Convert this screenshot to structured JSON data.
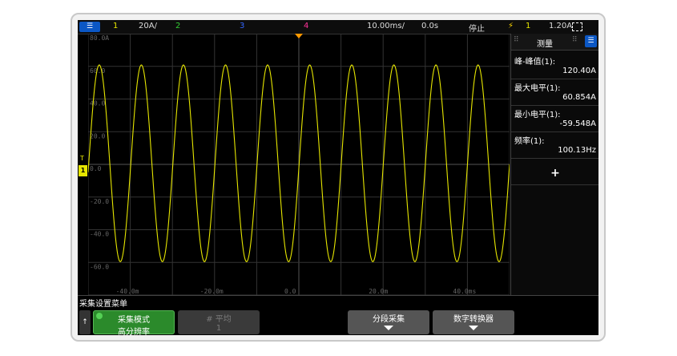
{
  "topbar": {
    "menu_icon": "menu-icon",
    "ch1": "1",
    "ch1_scale": "20A/",
    "ch2": "2",
    "ch3": "3",
    "ch4": "4",
    "timebase": "10.00ms/",
    "delay": "0.0s",
    "run_state": "停止",
    "trigger_icon": "trigger-edge-icon",
    "trigger_channel": "1",
    "trigger_level": "1.20A",
    "colors": {
      "ch1": "#e6e600",
      "ch2": "#33cc33",
      "ch3": "#3366ff",
      "ch4": "#ff3399",
      "trigger": "#ffd700"
    }
  },
  "grid": {
    "y_labels": [
      "80.0A",
      "60.0",
      "40.0",
      "20.0",
      "0.0",
      "-20.0",
      "-40.0",
      "-60.0"
    ],
    "x_labels": [
      "-40.0m",
      "-20.0m",
      "0.0",
      "20.0m",
      "40.0ms"
    ],
    "ground_marker": "1",
    "trigger_marker": "T"
  },
  "chart_data": {
    "type": "line",
    "series": [
      {
        "name": "1",
        "color": "#e6e600",
        "frequency_hz": 100.13,
        "max": 60.854,
        "min": -59.548
      }
    ],
    "x_range": [
      -50,
      50
    ],
    "x_unit": "ms",
    "y_range": [
      -80,
      80
    ],
    "y_unit": "A",
    "grid": true
  },
  "measurements": {
    "title": "测量",
    "items": [
      {
        "label": "峰-峰值(1):",
        "value": "120.40A"
      },
      {
        "label": "最大电平(1):",
        "value": "60.854A"
      },
      {
        "label": "最小电平(1):",
        "value": "-59.548A"
      },
      {
        "label": "频率(1):",
        "value": "100.13Hz"
      }
    ],
    "add_label": "+"
  },
  "softkeys": {
    "menu_title": "采集设置菜单",
    "back": "↑",
    "acq_mode_title": "采集模式",
    "acq_mode_value": "高分辨率",
    "avg_title": "# 平均",
    "avg_value": "1",
    "segmented": "分段采集",
    "digitizer": "数字转换器"
  }
}
